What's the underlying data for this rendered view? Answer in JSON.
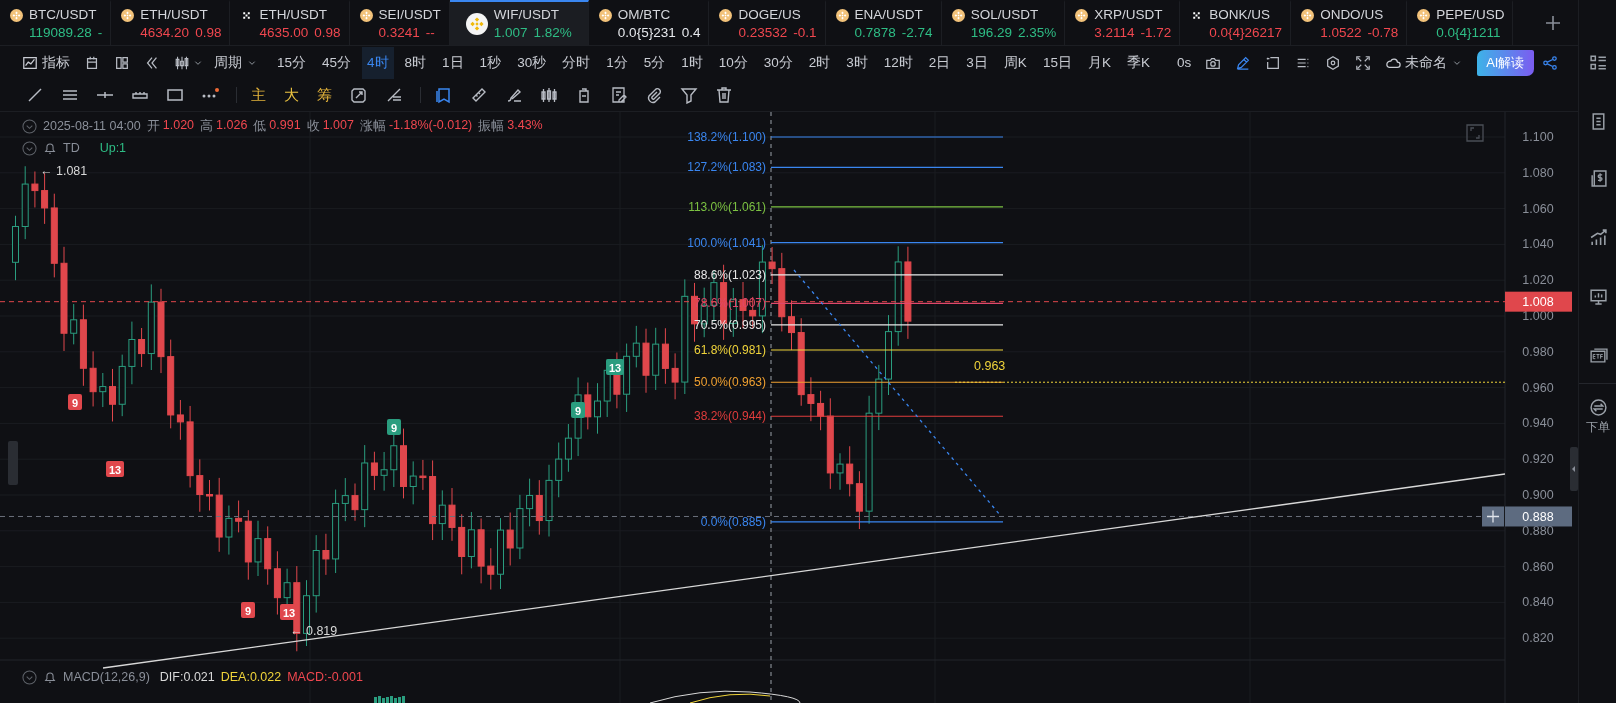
{
  "tabs": [
    {
      "kind": "coin",
      "pair": "BTC/USDT",
      "price": "119089.28",
      "change": "-",
      "color": "#2ebd85",
      "selected": false
    },
    {
      "kind": "coin",
      "pair": "ETH/USDT",
      "price": "4634.20",
      "change": "0.98",
      "color": "#f0474f",
      "selected": false
    },
    {
      "kind": "cross",
      "pair": "ETH/USDT",
      "price": "4635.00",
      "change": "0.98",
      "color": "#f0474f",
      "selected": false
    },
    {
      "kind": "coin",
      "pair": "SEI/USDT",
      "price": "0.3241",
      "change": "--",
      "color": "#f0474f",
      "selected": false
    },
    {
      "kind": "coin",
      "pair": "WIF/USDT",
      "price": "1.007",
      "change": "1.82%",
      "color": "#2ebd85",
      "selected": true
    },
    {
      "kind": "coin",
      "pair": "OM/BTC",
      "price": "0.0{5}231",
      "change": "0.4",
      "color": "#e6e8ec",
      "selected": false
    },
    {
      "kind": "coin",
      "pair": "DOGE/US",
      "price": "0.23532",
      "change": "-0.1",
      "color": "#f0474f",
      "selected": false
    },
    {
      "kind": "coin",
      "pair": "ENA/USDT",
      "price": "0.7878",
      "change": "-2.74",
      "color": "#2ebd85",
      "selected": false
    },
    {
      "kind": "coin",
      "pair": "SOL/USDT",
      "price": "196.29",
      "change": "2.35%",
      "color": "#2ebd85",
      "selected": false
    },
    {
      "kind": "coin",
      "pair": "XRP/USDT",
      "price": "3.2114",
      "change": "-1.72",
      "color": "#f0474f",
      "selected": false
    },
    {
      "kind": "cross",
      "pair": "BONK/US",
      "price": "0.0{4}26217",
      "color": "#f0474f",
      "selected": false
    },
    {
      "kind": "coin",
      "pair": "ONDO/US",
      "price": "1.0522",
      "change": "-0.78",
      "color": "#f0474f",
      "selected": false
    },
    {
      "kind": "coin",
      "pair": "PEPE/USD",
      "price": "0.0{4}1211",
      "color": "#2ebd85",
      "selected": false
    }
  ],
  "toolbar": {
    "indicator_label": "指标",
    "period_label": "周期",
    "intervals": [
      {
        "label": "15分",
        "selected": false
      },
      {
        "label": "45分",
        "selected": false
      },
      {
        "label": "4时",
        "selected": true
      },
      {
        "label": "8时",
        "selected": false
      },
      {
        "label": "1日",
        "selected": false
      },
      {
        "label": "1秒",
        "selected": false
      },
      {
        "label": "30秒",
        "selected": false
      },
      {
        "label": "分时",
        "selected": false
      },
      {
        "label": "1分",
        "selected": false
      },
      {
        "label": "5分",
        "selected": false
      },
      {
        "label": "1时",
        "selected": false
      },
      {
        "label": "10分",
        "selected": false
      },
      {
        "label": "30分",
        "selected": false
      },
      {
        "label": "2时",
        "selected": false
      },
      {
        "label": "3时",
        "selected": false
      },
      {
        "label": "12时",
        "selected": false
      },
      {
        "label": "2日",
        "selected": false
      },
      {
        "label": "3日",
        "selected": false
      },
      {
        "label": "周K",
        "selected": false
      },
      {
        "label": "15日",
        "selected": false
      },
      {
        "label": "月K",
        "selected": false
      },
      {
        "label": "季K",
        "selected": false
      }
    ],
    "timer": "0s",
    "layout_name": "未命名",
    "ai_button": "AI解读"
  },
  "drawing_tools": {
    "main_label": "主",
    "big_label": "大",
    "chip_label": "筹"
  },
  "chart": {
    "legend": {
      "date": "2025-08-11 04:00",
      "fields": [
        {
          "label": "开",
          "value": "1.020"
        },
        {
          "label": "高",
          "value": "1.026"
        },
        {
          "label": "低",
          "value": "0.991"
        },
        {
          "label": "收",
          "value": "1.007"
        },
        {
          "label": "涨幅",
          "value": "-1.18%(-0.012)"
        },
        {
          "label": "振幅",
          "value": "3.43%"
        }
      ]
    },
    "indicator": {
      "name": "TD",
      "signal": "Up:1"
    },
    "price_axis": [
      "1.100",
      "1.080",
      "1.060",
      "1.040",
      "1.020",
      "1.000",
      "0.980",
      "0.960",
      "0.940",
      "0.920",
      "0.900",
      "0.880",
      "0.860",
      "0.840",
      "0.820"
    ],
    "current_price": "1.008",
    "cursor_price": "0.888",
    "fib_levels": [
      {
        "label": "138.2%(1.100)",
        "color": "#3a86f0"
      },
      {
        "label": "127.2%(1.083)",
        "color": "#3a86f0"
      },
      {
        "label": "113.0%(1.061)",
        "color": "#7cc242"
      },
      {
        "label": "100.0%(1.041)",
        "color": "#3a86f0"
      },
      {
        "label": "88.6%(1.023)",
        "color": "#e8e8e8"
      },
      {
        "label": "78.6%(1.007)",
        "color": "#e0476a"
      },
      {
        "label": "70.5%(0.995)",
        "color": "#e8e8e8"
      },
      {
        "label": "61.8%(0.981)",
        "color": "#f0d43a"
      },
      {
        "label": "50.0%(0.963)",
        "color": "#f0a030"
      },
      {
        "label": "38.2%(0.944)",
        "color": "#e03c3c"
      },
      {
        "label": "0.0%(0.885)",
        "color": "#3a86f0"
      }
    ],
    "level_note": "0.963",
    "extremes": [
      {
        "label": "← 1.081"
      },
      {
        "label": "← 0.819"
      }
    ],
    "td_markers": [
      {
        "label": "9",
        "color": "#e0474c"
      },
      {
        "label": "13",
        "color": "#e0474c"
      },
      {
        "label": "9",
        "color": "#2a9d7f"
      },
      {
        "label": "9",
        "color": "#2a9d7f"
      },
      {
        "label": "13",
        "color": "#2a9d7f"
      },
      {
        "label": "9",
        "color": "#e0474c"
      },
      {
        "label": "13",
        "color": "#e0474c"
      }
    ],
    "macd": {
      "name": "MACD(12,26,9)",
      "dif": "DIF:0.021",
      "dea": "DEA:0.022",
      "macd": "MACD:-0.001"
    }
  },
  "sidebar": {
    "order_label": "下单"
  }
}
